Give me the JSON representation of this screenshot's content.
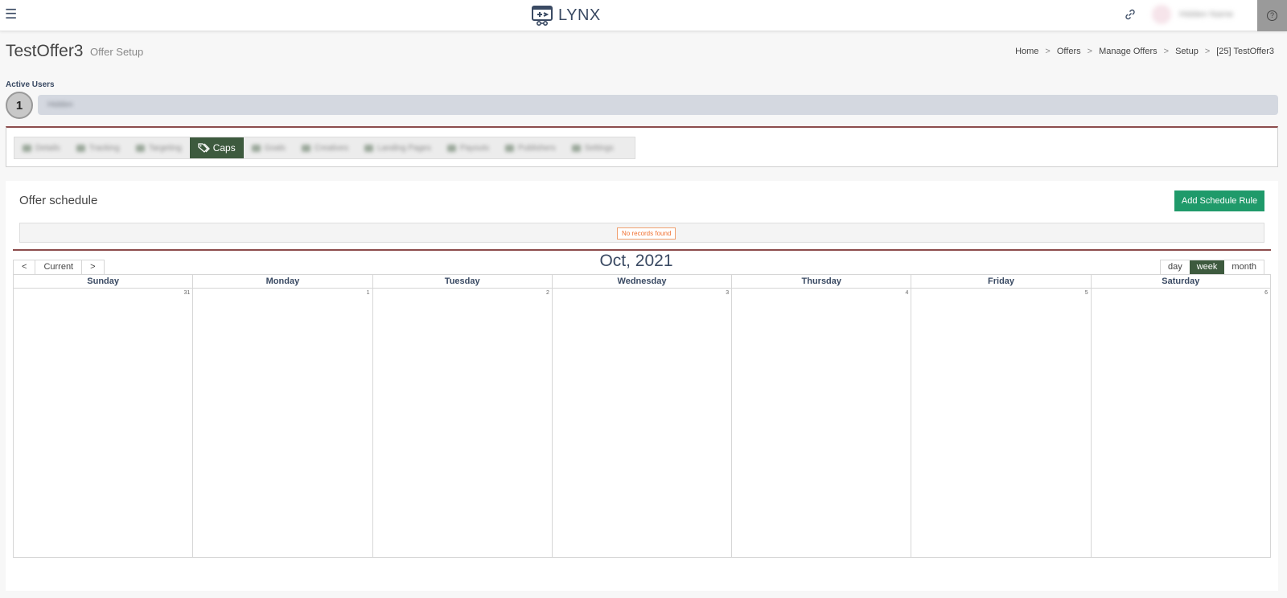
{
  "header": {
    "logo_text": "LYNX",
    "user_name": "Hidden Name"
  },
  "page": {
    "title": "TestOffer3",
    "subtitle": "Offer Setup"
  },
  "breadcrumb": [
    "Home",
    "Offers",
    "Manage Offers",
    "Setup",
    "[25] TestOffer3"
  ],
  "active_users": {
    "label": "Active Users",
    "count": "1",
    "name": "Hidden"
  },
  "tabs": [
    {
      "label": "Details",
      "active": false
    },
    {
      "label": "Tracking",
      "active": false
    },
    {
      "label": "Targeting",
      "active": false
    },
    {
      "label": "Caps",
      "active": true
    },
    {
      "label": "Goals",
      "active": false
    },
    {
      "label": "Creatives",
      "active": false
    },
    {
      "label": "Landing Pages",
      "active": false
    },
    {
      "label": "Payouts",
      "active": false
    },
    {
      "label": "Publishers",
      "active": false
    },
    {
      "label": "Settings",
      "active": false
    }
  ],
  "schedule": {
    "title": "Offer schedule",
    "add_button": "Add Schedule Rule",
    "no_records": "No records found"
  },
  "calendar": {
    "title": "Oct, 2021",
    "prev": "<",
    "current": "Current",
    "next": ">",
    "views": [
      {
        "label": "day",
        "active": false
      },
      {
        "label": "week",
        "active": true
      },
      {
        "label": "month",
        "active": false
      }
    ],
    "days": [
      "Sunday",
      "Monday",
      "Tuesday",
      "Wednesday",
      "Thursday",
      "Friday",
      "Saturday"
    ],
    "dates": [
      "31",
      "1",
      "2",
      "3",
      "4",
      "5",
      "6"
    ]
  }
}
